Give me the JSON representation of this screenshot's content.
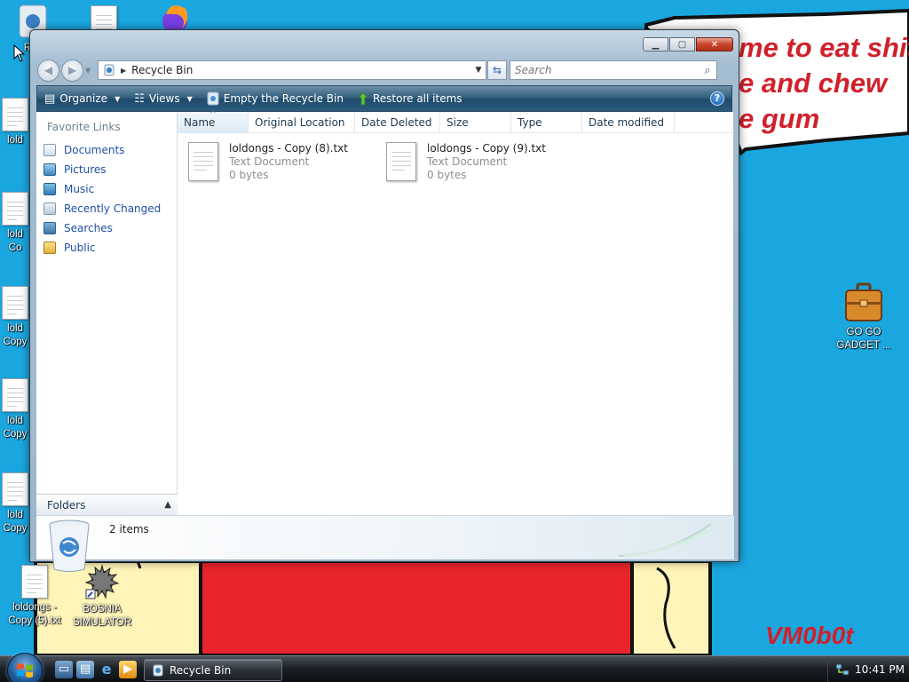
{
  "wallpaper": {
    "bubble_lines": [
      "me to eat shit",
      "e and chew",
      "e gum"
    ],
    "signature": "VM0b0t",
    "colors": {
      "sky": "#1aa7e0",
      "red": "#e8242c",
      "cream": "#fff5b8"
    }
  },
  "desktop": {
    "icons": [
      {
        "name": "Rec",
        "icon": "recycle-bin-icon"
      },
      {
        "name": "loldongs - Copy (5).txt",
        "line1": "loldongs -",
        "line2": "Copy (5).txt",
        "icon": "text-document-icon"
      },
      {
        "name": "BOSNIA SIMULATOR",
        "line1": "BOSNIA",
        "line2": "SIMULATOR",
        "icon": "game-shortcut-icon"
      },
      {
        "name": "GO GO GADGET ...",
        "line1": "GO GO",
        "line2": "GADGET ...",
        "icon": "briefcase-icon"
      },
      {
        "line1": "lold"
      },
      {
        "line1": "lold",
        "line2": "Co"
      },
      {
        "line1": "lold",
        "line2": "Copy"
      },
      {
        "line1": "lold",
        "line2": "Copy"
      },
      {
        "line1": "lold",
        "line2": "Copy"
      }
    ]
  },
  "window": {
    "title": "Recycle Bin",
    "address": {
      "crumb": "Recycle Bin"
    },
    "search_placeholder": "Search",
    "toolbar": {
      "organize": "Organize",
      "views": "Views",
      "empty": "Empty the Recycle Bin",
      "restore": "Restore all items",
      "help": "?"
    },
    "nav_pane": {
      "header": "Favorite Links",
      "links": [
        "Documents",
        "Pictures",
        "Music",
        "Recently Changed",
        "Searches",
        "Public"
      ],
      "folders_label": "Folders"
    },
    "columns": [
      "Name",
      "Original Location",
      "Date Deleted",
      "Size",
      "Type",
      "Date modified"
    ],
    "files": [
      {
        "name": "loldongs - Copy (8).txt",
        "type": "Text Document",
        "size": "0 bytes"
      },
      {
        "name": "loldongs - Copy (9).txt",
        "type": "Text Document",
        "size": "0 bytes"
      }
    ],
    "details": {
      "count": "2 items"
    }
  },
  "taskbar": {
    "task_label": "Recycle Bin",
    "clock": "10:41 PM"
  }
}
